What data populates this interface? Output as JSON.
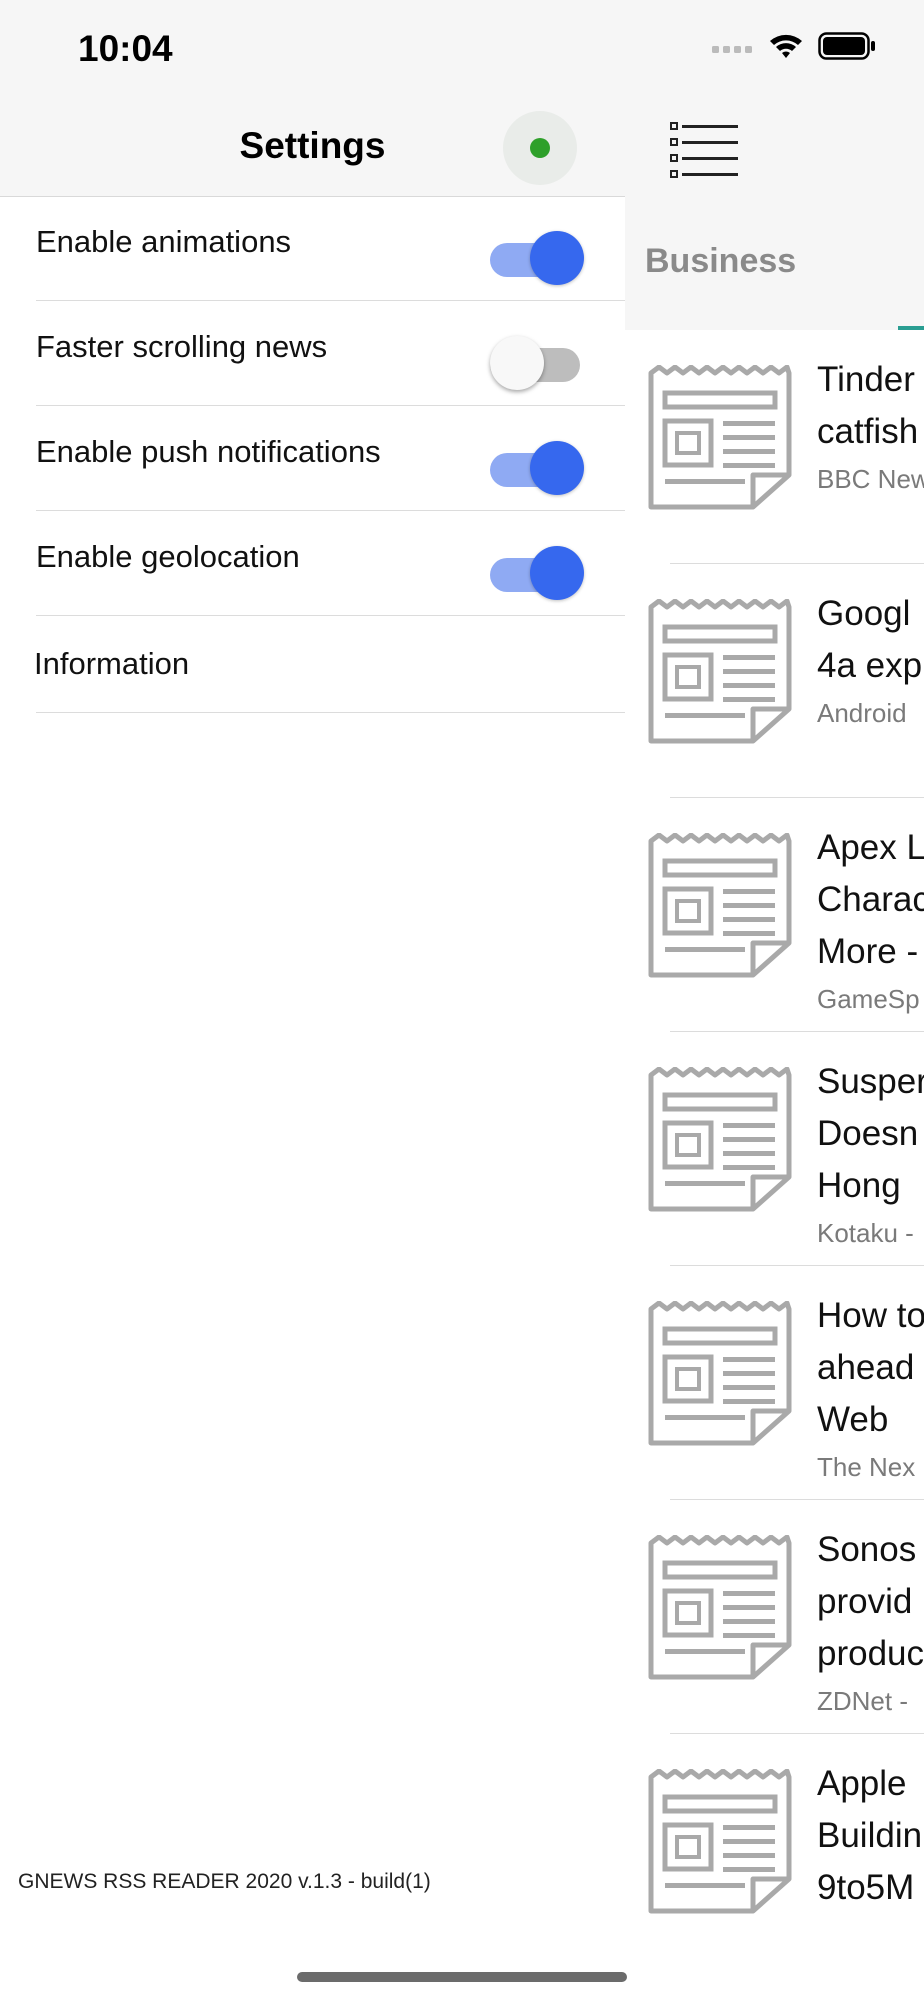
{
  "status_bar": {
    "time": "10:04"
  },
  "settings": {
    "title": "Settings",
    "status_color": "#2ea02a",
    "toggles": [
      {
        "label": "Enable animations",
        "on": true
      },
      {
        "label": "Faster scrolling news",
        "on": false
      },
      {
        "label": "Enable push notifications",
        "on": true
      },
      {
        "label": "Enable geolocation",
        "on": true
      }
    ],
    "information_label": "Information",
    "footer": "GNEWS RSS READER 2020 v.1.3 - build(1)",
    "accent_color": "#3668ee"
  },
  "news": {
    "category": "Business",
    "items": [
      {
        "lines": [
          "Tinder",
          "catfish"
        ],
        "source": "BBC New"
      },
      {
        "lines": [
          "Googl",
          "4a exp"
        ],
        "source": "Android"
      },
      {
        "lines": [
          "Apex L",
          "Charac",
          "More -"
        ],
        "source": "GameSp"
      },
      {
        "lines": [
          "Susper",
          "Doesn",
          "Hong"
        ],
        "source": "Kotaku -"
      },
      {
        "lines": [
          "How to",
          "ahead",
          "Web"
        ],
        "source": "The Nex"
      },
      {
        "lines": [
          "Sonos",
          "provid",
          "produc"
        ],
        "source": "ZDNet -"
      },
      {
        "lines": [
          "Apple",
          "Buildin",
          "9to5M"
        ],
        "source": ""
      }
    ]
  }
}
